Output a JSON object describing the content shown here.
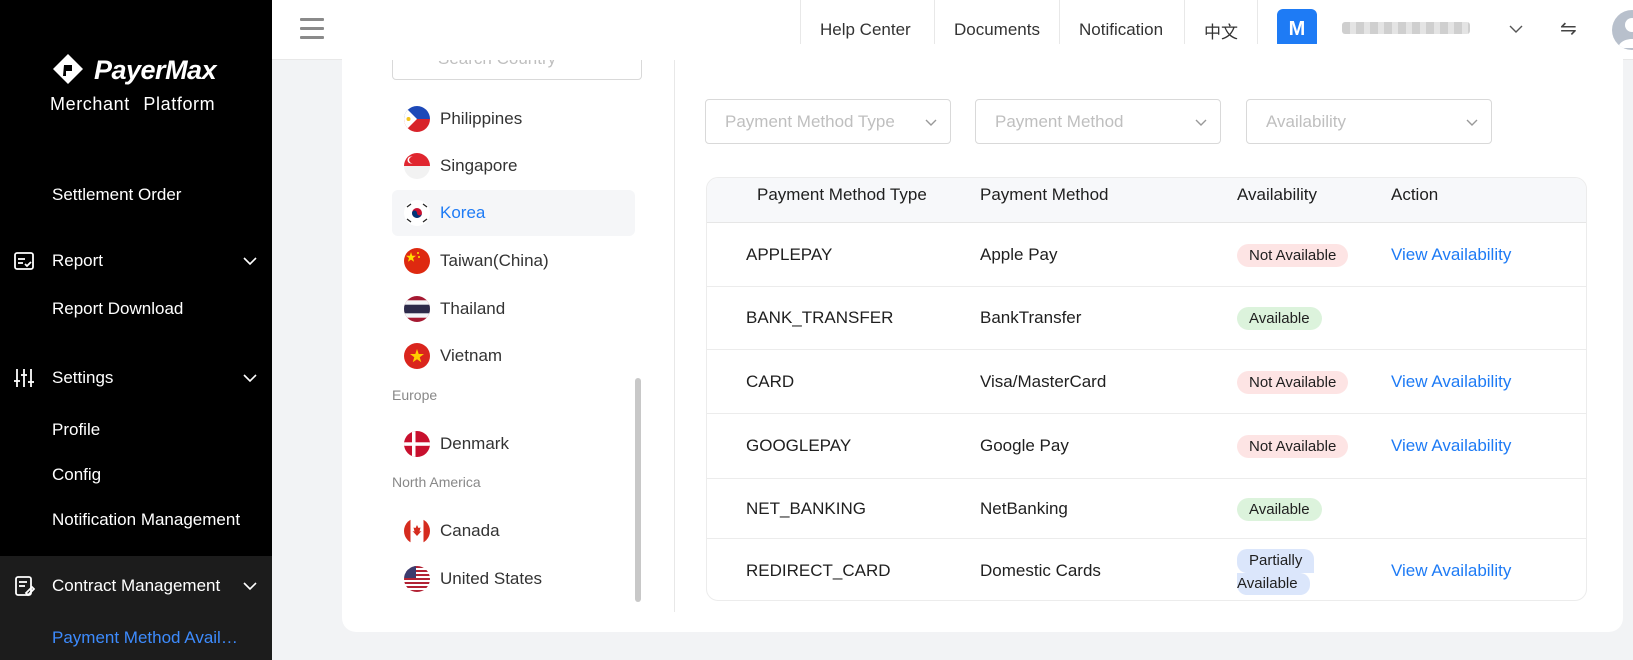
{
  "brand": {
    "name": "PayerMax",
    "subtitle": "Merchant Platform"
  },
  "sidebar": {
    "items": [
      {
        "label": "Settlement Order"
      },
      {
        "label": "Report"
      },
      {
        "label": "Report Download"
      },
      {
        "label": "Settings"
      },
      {
        "label": "Profile"
      },
      {
        "label": "Config"
      },
      {
        "label": "Notification Management"
      },
      {
        "label": "Contract Management"
      },
      {
        "label": "Payment Method Avail…"
      }
    ]
  },
  "topbar": {
    "links": [
      "Help Center",
      "Documents",
      "Notification",
      "中文"
    ],
    "user_initial": "M",
    "swap_glyph": "⇋"
  },
  "countries": {
    "search_placeholder": "Search Country",
    "list": [
      "Philippines",
      "Singapore",
      "Korea",
      "Taiwan(China)",
      "Thailand",
      "Vietnam"
    ],
    "regions": [
      "Europe",
      "North America"
    ],
    "europe": [
      "Denmark"
    ],
    "north_america": [
      "Canada",
      "United States"
    ],
    "selected": "Korea"
  },
  "filters": {
    "type_placeholder": "Payment Method Type",
    "method_placeholder": "Payment Method",
    "availability_placeholder": "Availability"
  },
  "table": {
    "headers": [
      "Payment Method Type",
      "Payment Method",
      "Availability",
      "Action"
    ],
    "rows": [
      {
        "type": "APPLEPAY",
        "method": "Apple Pay",
        "availability": "Not Available",
        "action": "View Availability"
      },
      {
        "type": "BANK_TRANSFER",
        "method": "BankTransfer",
        "availability": "Available",
        "action": ""
      },
      {
        "type": "CARD",
        "method": "Visa/MasterCard",
        "availability": "Not Available",
        "action": "View Availability"
      },
      {
        "type": "GOOGLEPAY",
        "method": "Google Pay",
        "availability": "Not Available",
        "action": "View Availability"
      },
      {
        "type": "NET_BANKING",
        "method": "NetBanking",
        "availability": "Available",
        "action": ""
      },
      {
        "type": "REDIRECT_CARD",
        "method": "Domestic Cards",
        "availability_line1": "Partially",
        "availability_line2": "Available",
        "action": "View Availability"
      }
    ]
  },
  "colors": {
    "accent": "#1e7bf5",
    "sidebar_bg": "#000000",
    "not_available_bg": "#fde4e4",
    "available_bg": "#dcf3dc",
    "partial_bg": "#dbe6fb"
  }
}
